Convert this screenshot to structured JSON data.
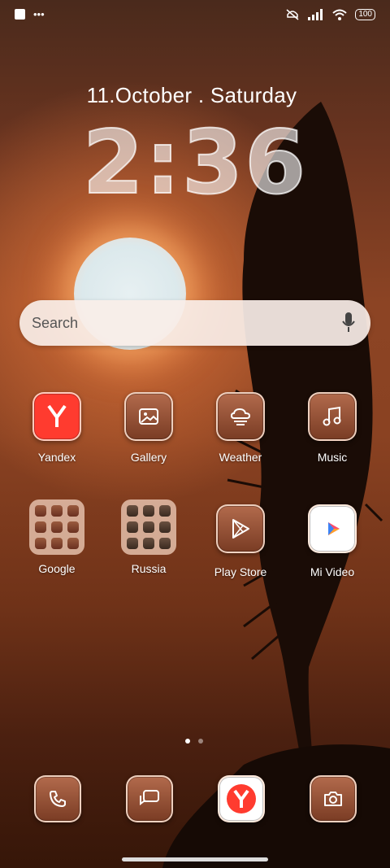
{
  "status_bar": {
    "battery": "100"
  },
  "lock": {
    "date": "11.October . Saturday",
    "time": "2:36"
  },
  "search": {
    "placeholder": "Search"
  },
  "apps_row1": [
    {
      "label": "Yandex",
      "icon": "yandex-icon"
    },
    {
      "label": "Gallery",
      "icon": "gallery-icon"
    },
    {
      "label": "Weather",
      "icon": "weather-icon"
    },
    {
      "label": "Music",
      "icon": "music-icon"
    }
  ],
  "apps_row2": [
    {
      "label": "Google",
      "icon": "folder-icon"
    },
    {
      "label": "Russia",
      "icon": "folder-icon"
    },
    {
      "label": "Play Store",
      "icon": "play-store-icon"
    },
    {
      "label": "Mi Video",
      "icon": "mi-video-icon"
    }
  ],
  "dock": [
    {
      "icon": "phone-icon"
    },
    {
      "icon": "messages-icon"
    },
    {
      "icon": "yandex-browser-icon"
    },
    {
      "icon": "camera-icon"
    }
  ],
  "colors": {
    "yandex_red": "#ff3b2f",
    "tile_border": "#f3dccd"
  }
}
